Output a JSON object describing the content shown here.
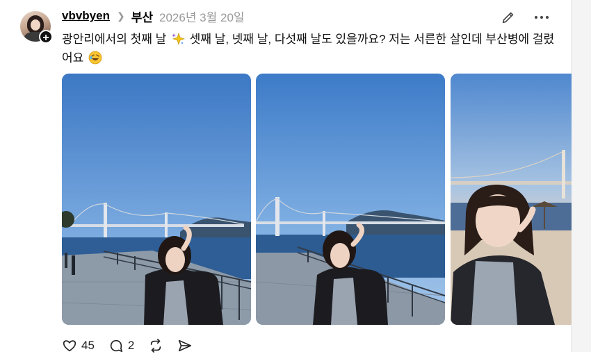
{
  "post": {
    "username": "vbvbyen",
    "topic": "부산",
    "timestamp": "2026년 3월 20일",
    "caption_part1": "광안리에서의 첫째 날",
    "caption_part2": "셋째 날, 넷째 날, 다섯째 날도 있을까요? 저는 서른한 살인데 부산병에 걸렸어요",
    "follow_badge": "+"
  },
  "actions": {
    "likes": "45",
    "comments": "2"
  },
  "icons": {
    "edit": "pencil-icon",
    "more": "more-horizontal-icon",
    "like": "heart-icon",
    "comment": "comment-icon",
    "repost": "repost-icon",
    "share": "share-icon",
    "sparkle": "sparkles-emoji",
    "laugh": "rolling-laugh-emoji"
  },
  "colors": {
    "sky": "#5d8fcf",
    "sea": "#2f5f9a",
    "text_muted": "#999999"
  }
}
